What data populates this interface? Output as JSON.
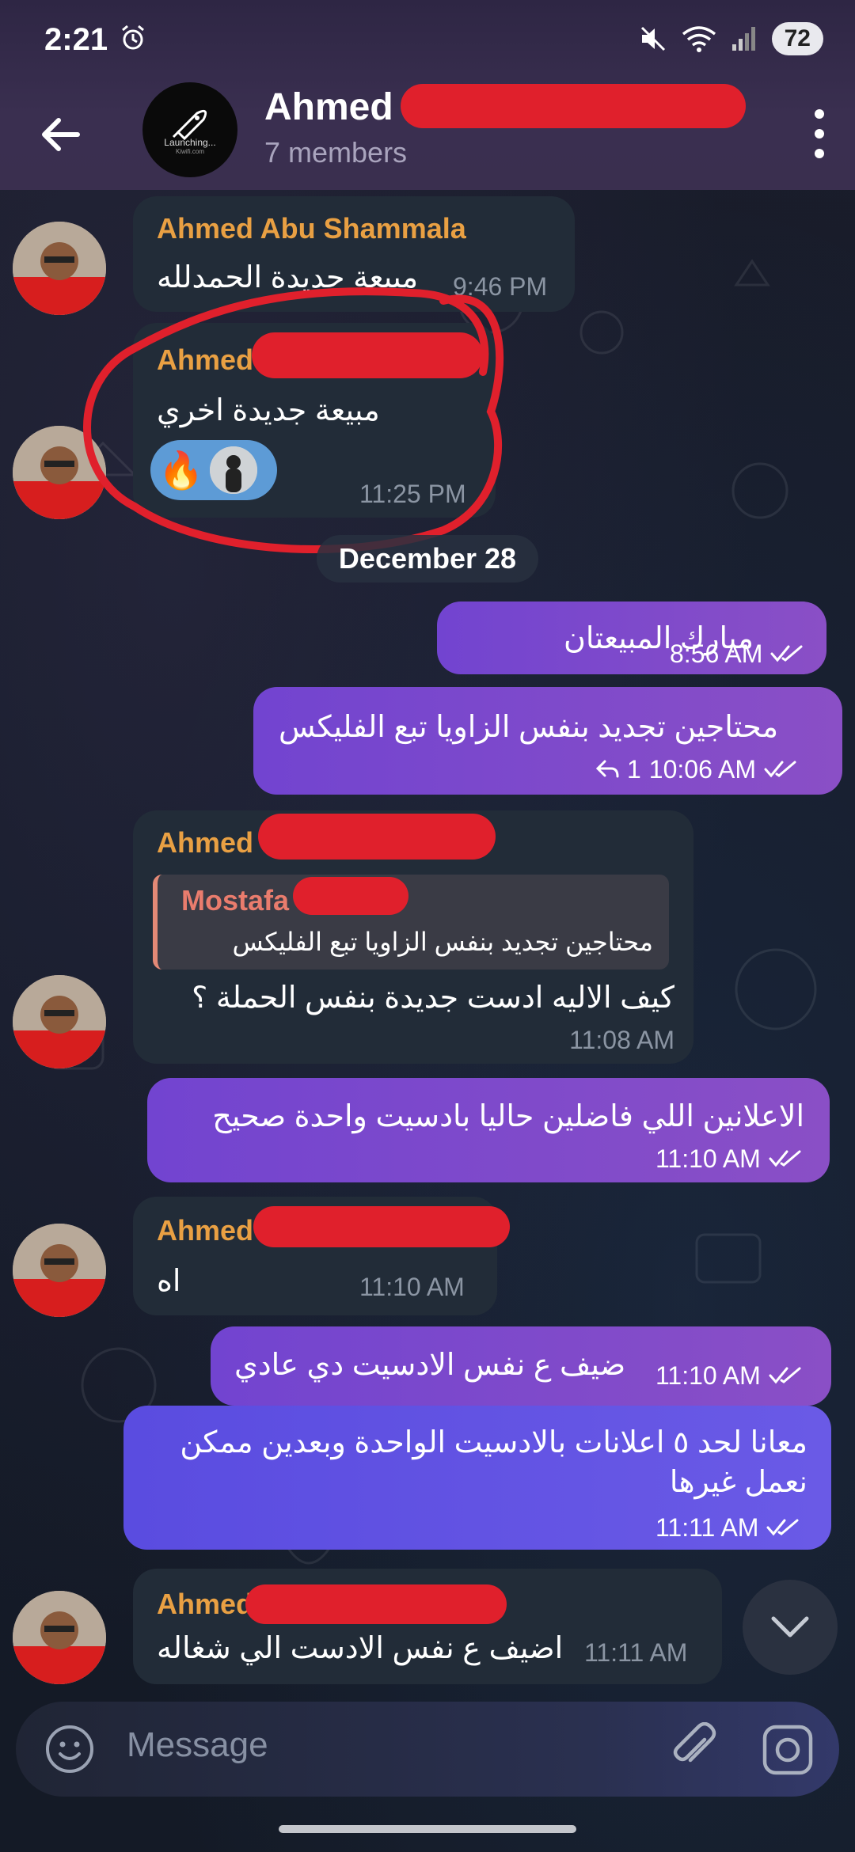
{
  "status_bar": {
    "time": "2:21",
    "battery": "72"
  },
  "header": {
    "title": "Ahmed",
    "members": "7 members",
    "avatar_text": "Launching...",
    "avatar_subtext": "Kiwifi.com"
  },
  "messages": [
    {
      "sender": "Ahmed Abu Shammala",
      "text": "مبيعة جديدة الحمدلله",
      "time": "9:46 PM"
    },
    {
      "sender": "Ahmed",
      "text": "مبيعة جديدة اخري",
      "time": "11:25 PM",
      "reaction": "🔥"
    },
    {
      "date": "December 28"
    },
    {
      "text": "مبارك المبيعتان",
      "time": "8:56 AM"
    },
    {
      "text": "محتاجين تجديد بنفس الزاويا تبع الفليكس",
      "time": "10:06 AM",
      "replies": "1"
    },
    {
      "sender": "Ahmed",
      "quote_name": "Mostafa",
      "quote_text": "محتاجين تجديد بنفس الزاويا تبع الفليكس",
      "text": "كيف الاليه ادست جديدة بنفس الحملة ؟",
      "time": "11:08 AM"
    },
    {
      "text": "الاعلانين اللي فاضلين حاليا بادسيت واحدة صحيح",
      "time": "11:10 AM"
    },
    {
      "sender": "Ahmed",
      "text": "اه",
      "time": "11:10 AM"
    },
    {
      "text": "ضيف ع نفس الادسيت دي عادي",
      "time": "11:10 AM"
    },
    {
      "text_line1": "معانا لحد ٥ اعلانات بالادسيت الواحدة وبعدين ممكن",
      "text_line2": "نعمل غيرها",
      "time": "11:11 AM"
    },
    {
      "sender": "Ahmed",
      "text": "اضيف ع نفس الادست الي شغاله",
      "time": "11:11 AM"
    }
  ],
  "input": {
    "placeholder": "Message"
  },
  "colors": {
    "outgoing": "#7e48cc",
    "incoming": "#222c38",
    "sender_name": "#e9a043",
    "annotation": "#e0202c"
  }
}
